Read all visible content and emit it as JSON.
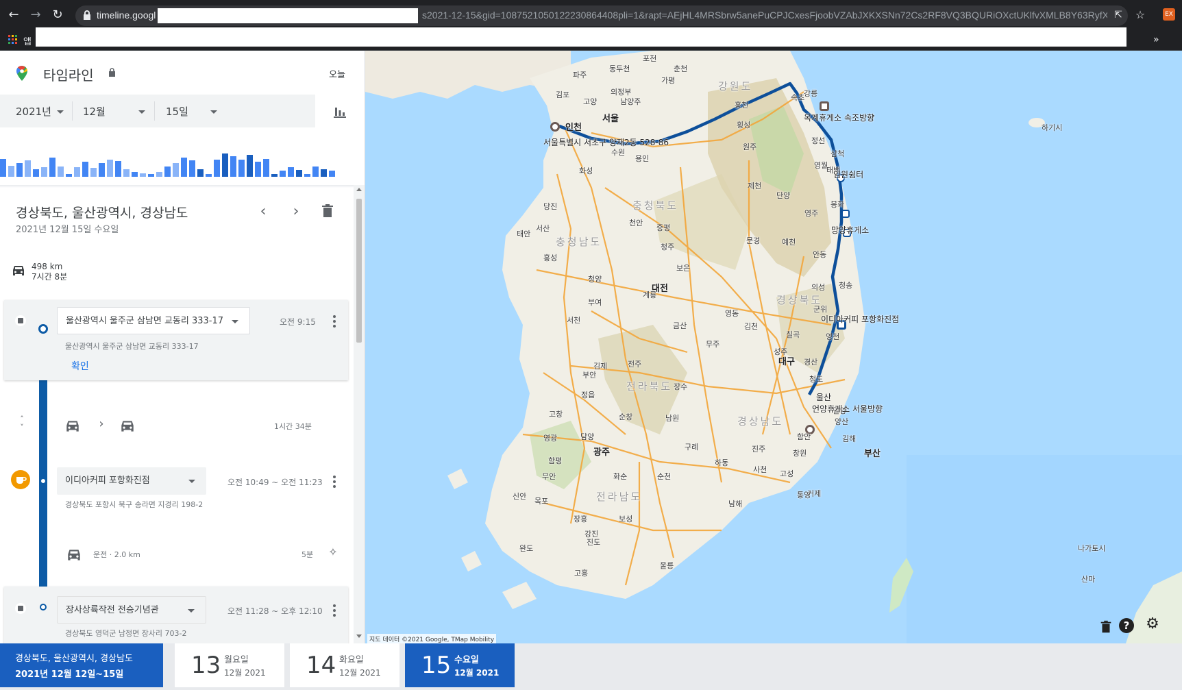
{
  "browser": {
    "url_host": "timeline.googl",
    "url_rest": "s2021-12-15&gid=1087521050122230864408pli=1&rapt=AEjHL4MRSbrw5anePuCPJCxesFjoobVZAbJXKXSNn72Cs2RF8VQ3BQURiOXctUKlfvXMLB8Y63RyfXI...",
    "bookmarks_apps_label": "앱",
    "extension_label": "EX"
  },
  "header": {
    "title": "타임라인",
    "today_label": "오늘"
  },
  "date_picker": {
    "year": "2021년",
    "month": "12월",
    "day": "15일"
  },
  "histogram": {
    "values": [
      0.72,
      0.45,
      0.55,
      0.68,
      0.3,
      0.4,
      0.78,
      0.42,
      0.12,
      0.38,
      0.6,
      0.35,
      0.55,
      0.7,
      0.65,
      0.3,
      0.2,
      0.15,
      0.1,
      0.2,
      0.42,
      0.55,
      0.78,
      0.68,
      0.3,
      0.1,
      0.7,
      0.95,
      0.82,
      0.7,
      0.88,
      0.6,
      0.72,
      0.1,
      0.25,
      0.4,
      0.28,
      0.1,
      0.42,
      0.3,
      0.24
    ],
    "colors": {
      "light": "#8ab4f8",
      "mid": "#4285f4",
      "dark": "#1a5fbf"
    }
  },
  "day": {
    "title": "경상북도, 울산광역시, 경상남도",
    "date": "2021년 12월 15일 수요일",
    "distance": "498 km",
    "duration": "7시간 8분"
  },
  "timeline": {
    "items": [
      {
        "place": "울산광역시 울주군 삼남면 교동리 333-17",
        "address": "울산광역시 울주군 삼남면 교동리 333-17",
        "time": "오전 9:15",
        "confirm_label": "확인"
      },
      {
        "transit_duration": "1시간 34분"
      },
      {
        "place": "이디아커피 포항화진점",
        "address": "경상북도 포항시 북구 송라면 지경리 198-2",
        "time": "오전 10:49 ~ 오전 11:23",
        "drive_label": "운전 · 2.0 km",
        "drive_duration": "5분"
      },
      {
        "place": "장사상륙작전 전승기념관",
        "address": "경상북도 영덕군 남정면 장사리 703-2",
        "time": "오전 11:28 ~ 오후 12:10"
      }
    ]
  },
  "map": {
    "attribution": "지도 데이터 ©2021 Google, TMap Mobility",
    "cities": [
      "포천",
      "동두천",
      "춘천",
      "파주",
      "가평",
      "의정부",
      "강원도",
      "김포",
      "고양",
      "남양주",
      "서울",
      "인천",
      "홍천",
      "속초",
      "횡성",
      "원주",
      "강릉",
      "정선",
      "수원",
      "용인",
      "화성",
      "영월",
      "충청북도",
      "제천",
      "태백",
      "삼척",
      "당진",
      "단양",
      "봉화",
      "서산",
      "태안",
      "천안",
      "증평",
      "영주",
      "충청남도",
      "청주",
      "문경",
      "예천",
      "안동",
      "홍성",
      "보은",
      "청양",
      "대전",
      "계룡",
      "의성",
      "부여",
      "영동",
      "경상북도",
      "청송",
      "서천",
      "금산",
      "김천",
      "군위",
      "무주",
      "칠곡",
      "영천",
      "김제",
      "전주",
      "성주",
      "대구",
      "경산",
      "부안",
      "장수",
      "청도",
      "전라북도",
      "정읍",
      "밀양",
      "양산",
      "고창",
      "순창",
      "남원",
      "경상남도",
      "함안",
      "김해",
      "담양",
      "광주",
      "구례",
      "진주",
      "창원",
      "부산",
      "영광",
      "함평",
      "하동",
      "사천",
      "고성",
      "무안",
      "화순",
      "순천",
      "통영",
      "거제",
      "신안",
      "목포",
      "보성",
      "전라남도",
      "남해",
      "장흥",
      "강진",
      "진도",
      "완도",
      "고흥",
      "울릉",
      "하기시",
      "나가토시",
      "산마"
    ],
    "route_labels": [
      "옥계휴게소 속조방향",
      "서울특별시 서초구 양재2동 528-86",
      "임원쉼터",
      "망양휴게소",
      "이디아커피 포항화진점",
      "울산",
      "언양휴게소 서울방향"
    ],
    "route_color": "#0d4f9a"
  },
  "bottom_strip": {
    "range_title": "경상북도, 울산광역시, 경상남도",
    "range_dates": "2021년 12월 12일~15일",
    "days": [
      {
        "num": "13",
        "weekday": "월요일",
        "month_year": "12월 2021"
      },
      {
        "num": "14",
        "weekday": "화요일",
        "month_year": "12월 2021"
      },
      {
        "num": "15",
        "weekday": "수요일",
        "month_year": "12월 2021"
      }
    ]
  }
}
